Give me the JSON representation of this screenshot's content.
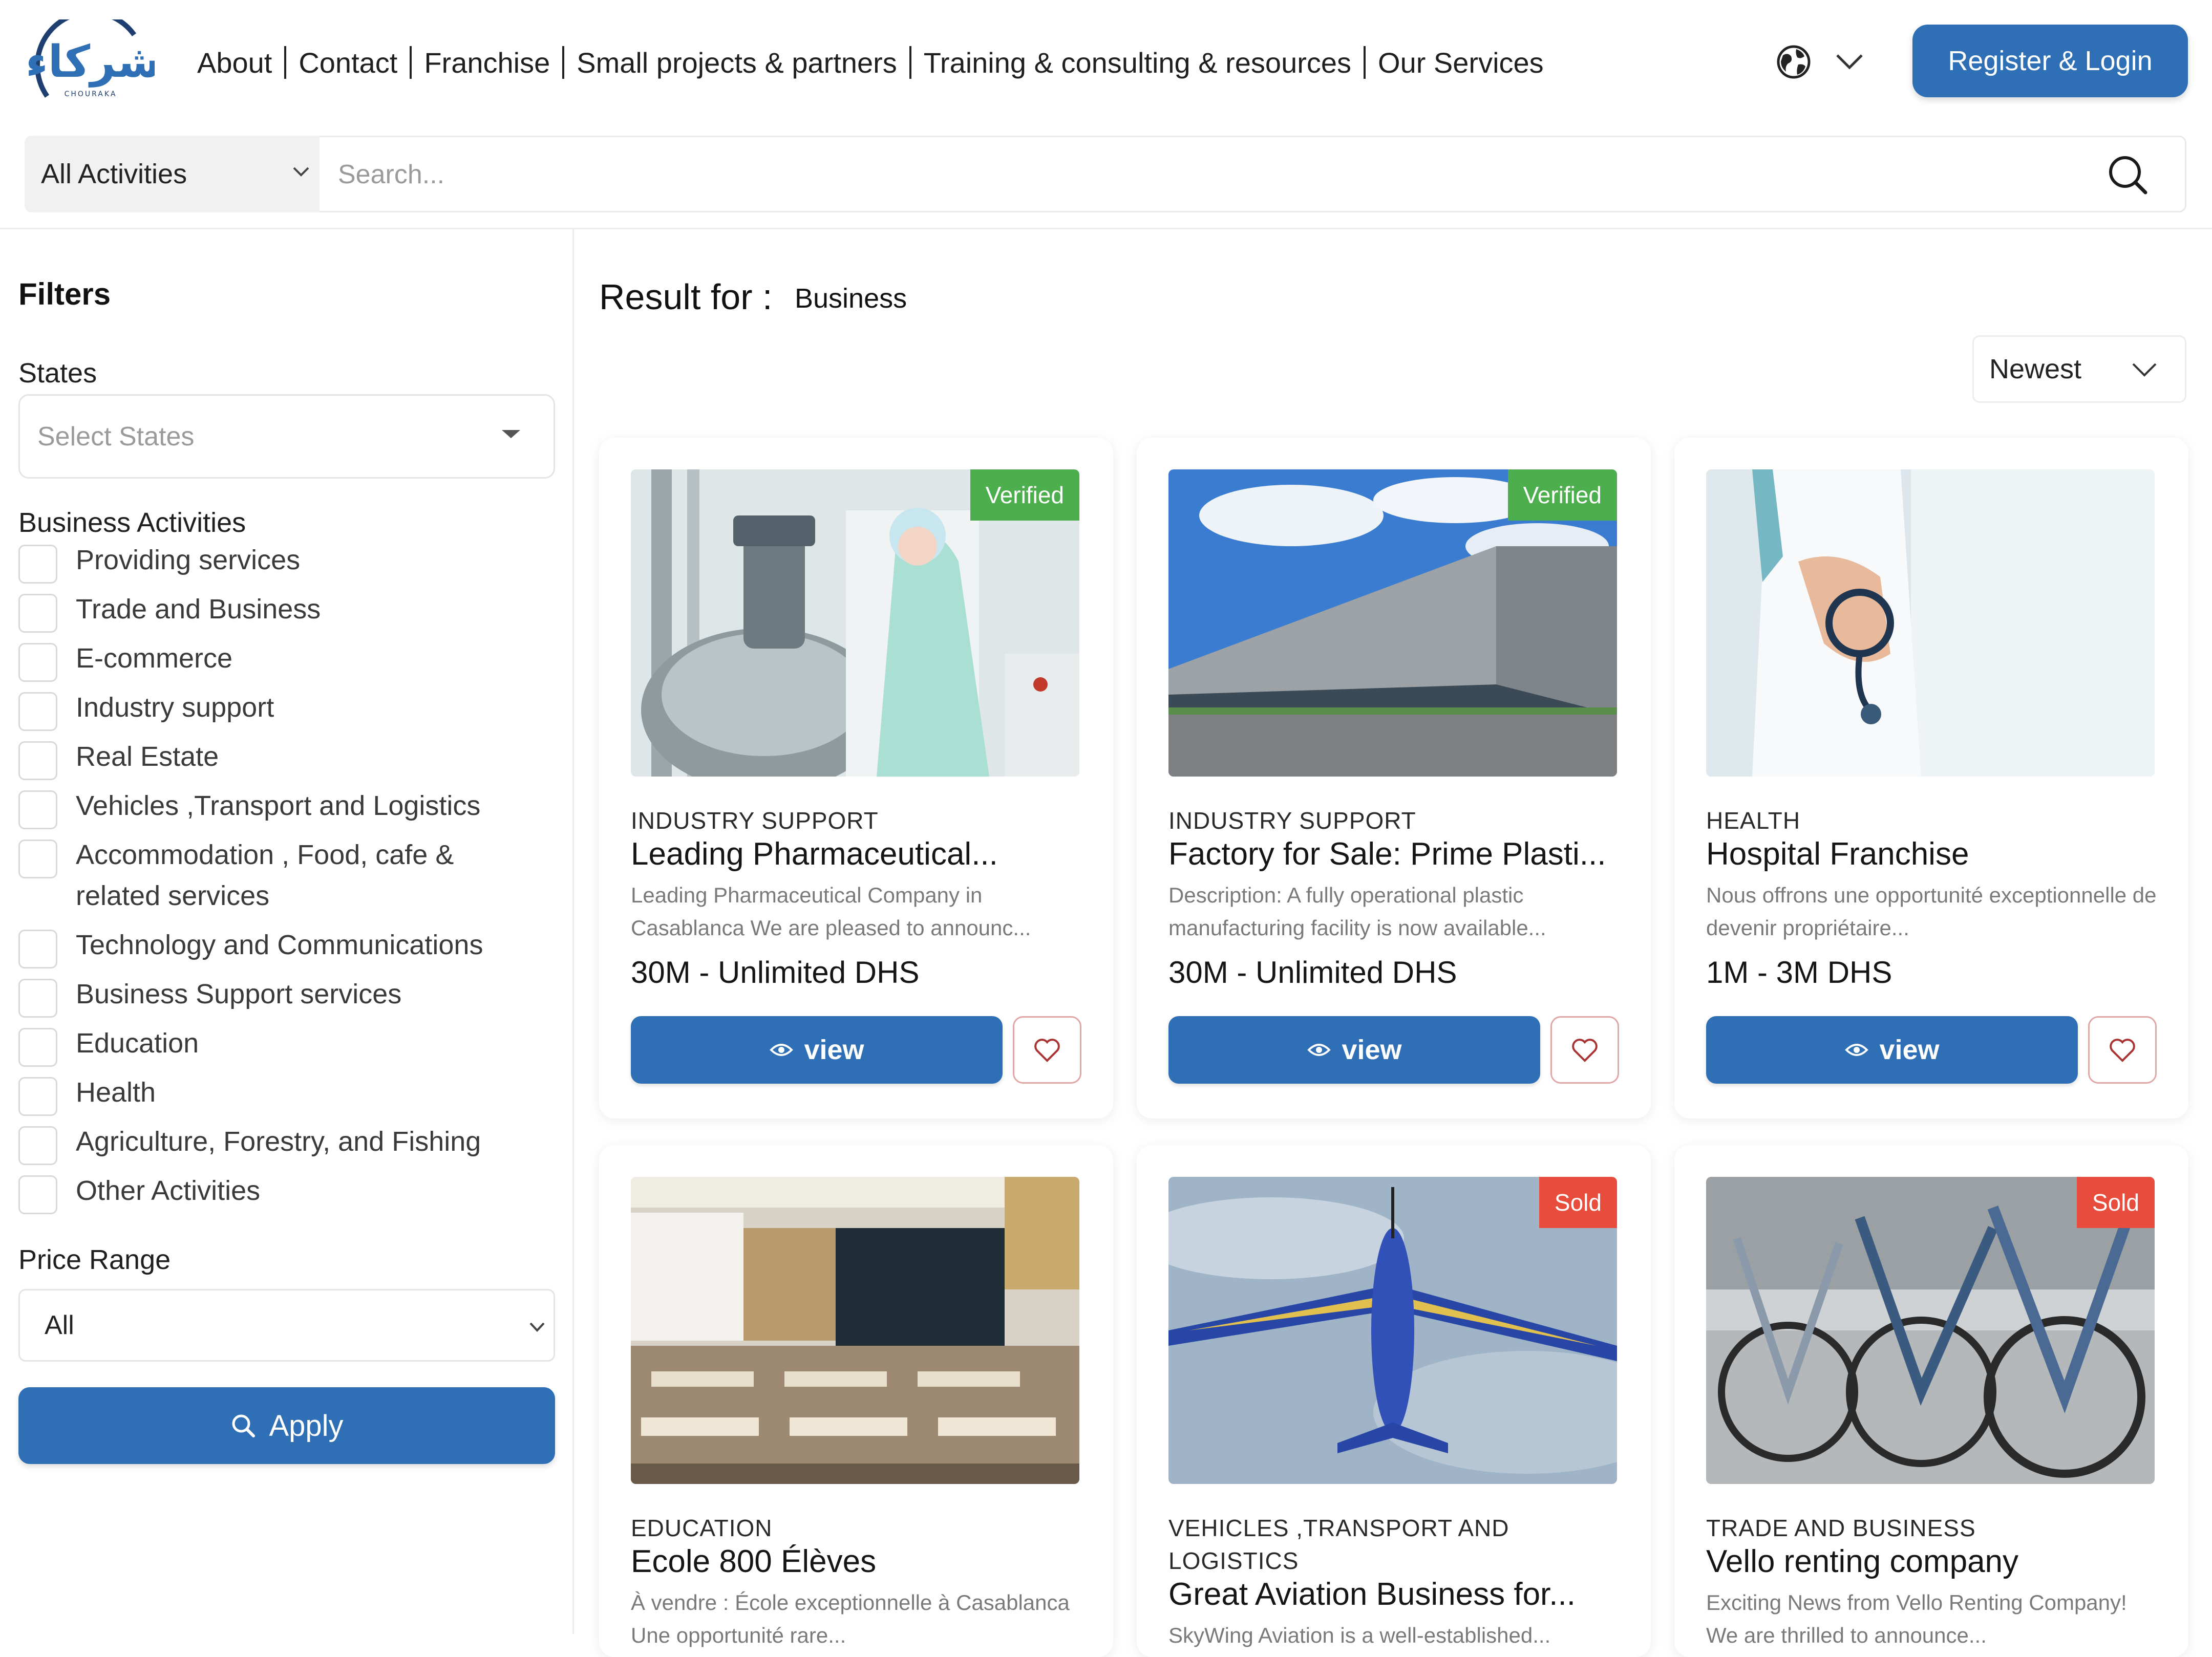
{
  "header": {
    "logo_text": "شركاء",
    "logo_subtext": "CHOURAKA",
    "nav": [
      "About",
      "Contact",
      "Franchise",
      "Small projects & partners",
      "Training & consulting & resources",
      "Our Services"
    ],
    "language_icon": "globe-icon",
    "register_label": "Register & Login"
  },
  "search": {
    "category": "All Activities",
    "placeholder": "Search..."
  },
  "filters": {
    "title": "Filters",
    "states_label": "States",
    "states_placeholder": "Select States",
    "activities_label": "Business Activities",
    "activities": [
      "Providing services",
      "Trade and Business",
      "E-commerce",
      "Industry support",
      "Real Estate",
      "Vehicles ,Transport and Logistics",
      "Accommodation , Food, cafe & related services",
      "Technology and Communications",
      "Business Support services",
      "Education",
      "Health",
      "Agriculture, Forestry, and Fishing",
      "Other Activities"
    ],
    "price_label": "Price Range",
    "price_value": "All",
    "apply_label": "Apply"
  },
  "results": {
    "title": "Result for :",
    "term": "Business",
    "sort": "Newest",
    "view_label": "view",
    "cards": [
      {
        "category": "INDUSTRY SUPPORT",
        "title": "Leading Pharmaceutical...",
        "description": "Leading Pharmaceutical Company in Casablanca We are pleased to announc...",
        "price": "30M - Unlimited DHS",
        "badge": "Verified",
        "image": "pharmaceutical-lab-photo"
      },
      {
        "category": "INDUSTRY SUPPORT",
        "title": "Factory for Sale: Prime Plasti...",
        "description": "Description: A fully operational plastic manufacturing facility is now available...",
        "price": "30M - Unlimited DHS",
        "badge": "Verified",
        "image": "factory-building-photo"
      },
      {
        "category": "HEALTH",
        "title": "Hospital Franchise",
        "description": "Nous offrons une opportunité exceptionnelle de devenir propriétaire...",
        "price": "1M - 3M DHS",
        "badge": "",
        "image": "doctor-stethoscope-photo"
      },
      {
        "category": "EDUCATION",
        "title": "Ecole 800 Élèves",
        "description": "À vendre : École exceptionnelle à Casablanca Une opportunité rare...",
        "price": "",
        "badge": "",
        "image": "classroom-photo"
      },
      {
        "category": "VEHICLES ,TRANSPORT AND LOGISTICS",
        "title": "Great Aviation Business for...",
        "description": "SkyWing Aviation is a well-established...",
        "price": "",
        "badge": "Sold",
        "image": "airplane-photo"
      },
      {
        "category": "TRADE AND BUSINESS",
        "title": "Vello renting company",
        "description": "Exciting News from Vello Renting Company! We are thrilled to announce...",
        "price": "",
        "badge": "Sold",
        "image": "bicycles-photo"
      }
    ]
  },
  "colors": {
    "primary": "#2f6fb5",
    "verified": "#4cae4c",
    "sold": "#e74c3c"
  }
}
